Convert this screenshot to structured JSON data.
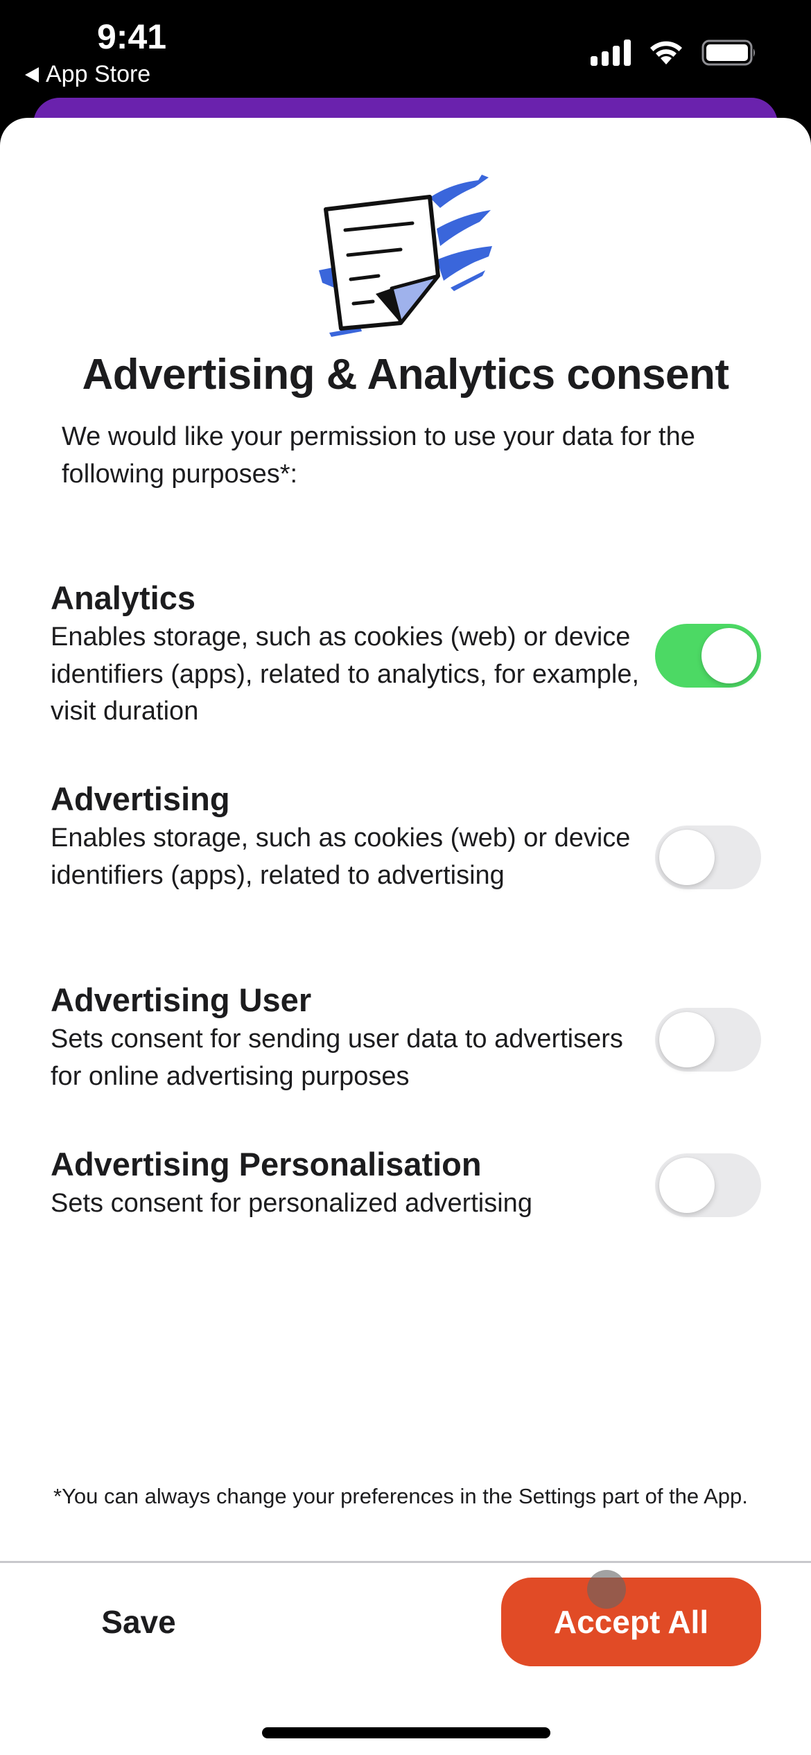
{
  "status_bar": {
    "time": "9:41",
    "back_label": "App Store",
    "icons": [
      "cellular-signal-icon",
      "wifi-icon",
      "battery-icon"
    ]
  },
  "dialog": {
    "illustration": "document-icon",
    "title": "Advertising & Analytics consent",
    "intro": "We would like your permission to use your data for the following purposes*:",
    "purposes": [
      {
        "title": "Analytics",
        "description": "Enables storage, such as cookies (web) or device identifiers (apps), related to analytics, for example, visit duration",
        "enabled": true
      },
      {
        "title": "Advertising",
        "description": "Enables storage, such as cookies (web) or device identifiers (apps), related to advertising",
        "enabled": false
      },
      {
        "title": "Advertising User",
        "description": "Sets consent for sending user data to advertisers for online advertising purposes",
        "enabled": false
      },
      {
        "title": "Advertising Personalisation",
        "description": "Sets consent for personalized advertising",
        "enabled": false
      }
    ],
    "footnote": "*You can always change your preferences in the Settings part of the App.",
    "save_label": "Save",
    "accept_all_label": "Accept All"
  },
  "colors": {
    "accent_purple": "#6a22ad",
    "toggle_on": "#4cd964",
    "toggle_off": "#e9e9eb",
    "accept_button": "#e14b26",
    "illustration_blue": "#3a66db"
  }
}
